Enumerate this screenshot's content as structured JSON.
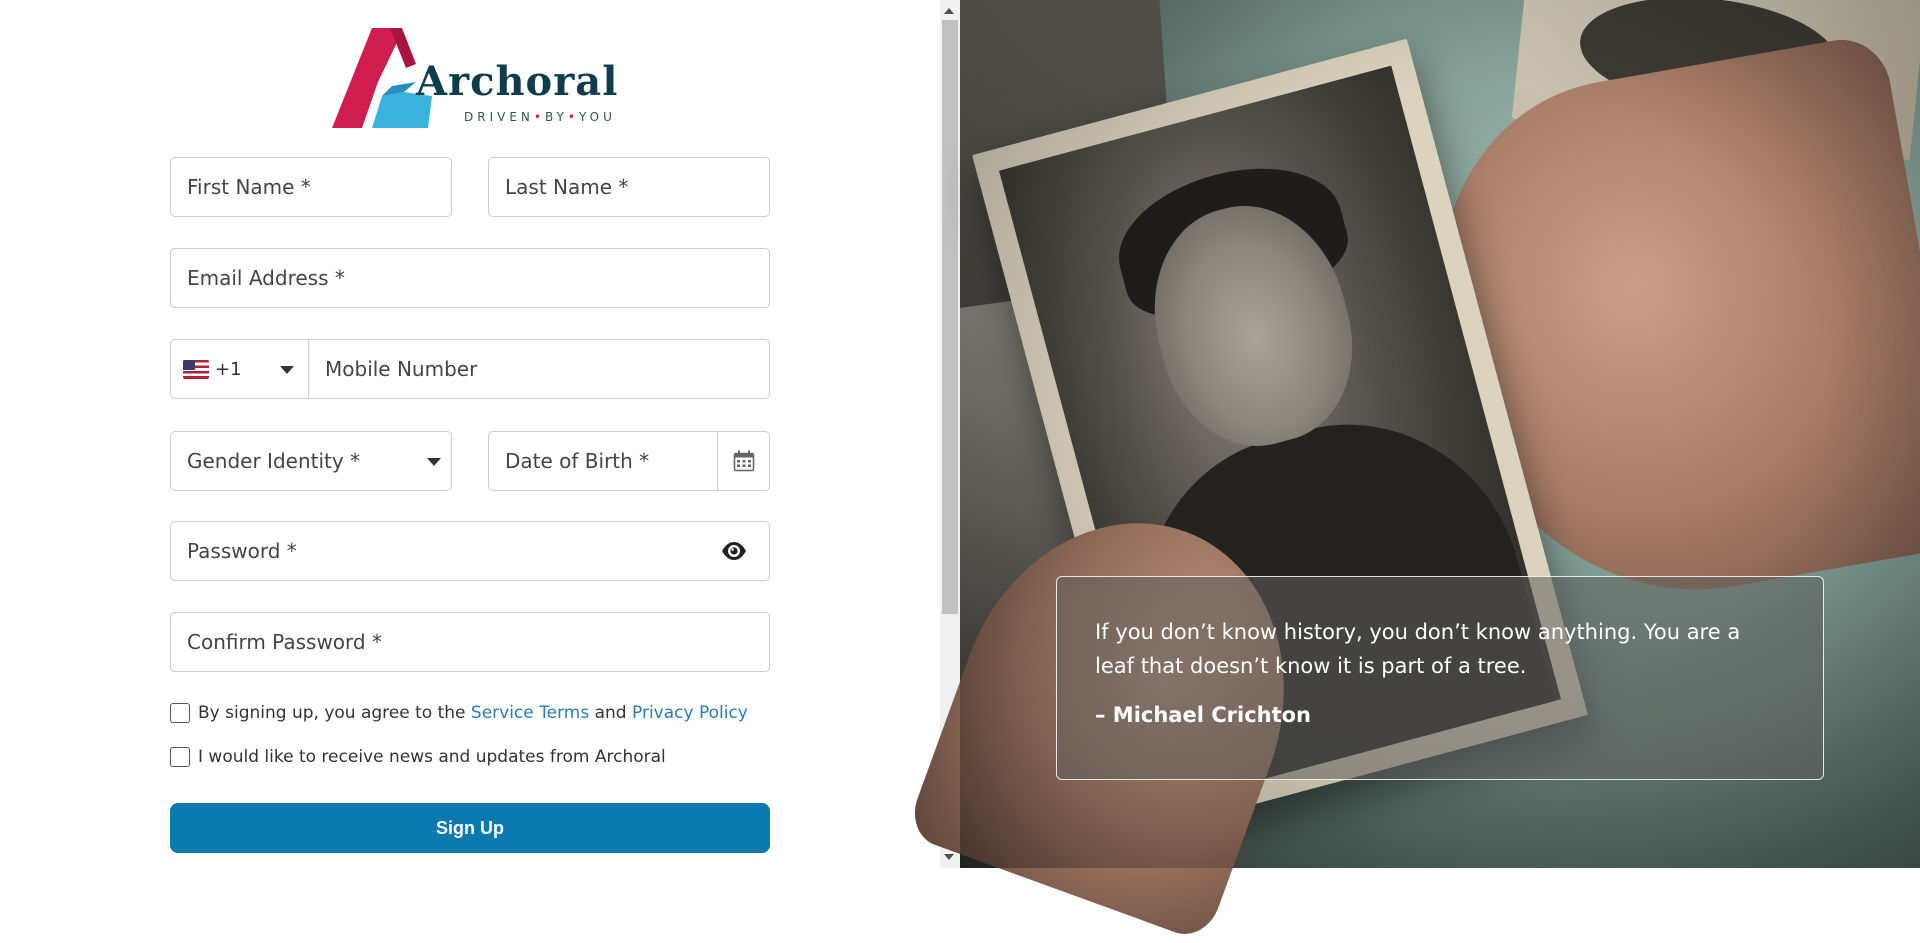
{
  "brand": {
    "name": "Archoral",
    "tagline_parts": [
      "DRIVEN",
      "BY",
      "YOU"
    ],
    "colors": {
      "primary": "#0b78ae",
      "logo_red": "#cf1d50",
      "logo_blue": "#3ab4dd",
      "logo_text": "#103d4e",
      "link": "#2a7bb5"
    }
  },
  "form": {
    "first_name": {
      "placeholder": "First Name *",
      "value": ""
    },
    "last_name": {
      "placeholder": "Last Name *",
      "value": ""
    },
    "email": {
      "placeholder": "Email Address *",
      "value": ""
    },
    "phone": {
      "country_flag": "us-flag-icon",
      "dial_code": "+1",
      "placeholder": "Mobile Number",
      "value": ""
    },
    "gender": {
      "placeholder": "Gender Identity *",
      "selected": ""
    },
    "dob": {
      "placeholder": "Date of Birth *",
      "value": "",
      "icon": "calendar-icon"
    },
    "password": {
      "placeholder": "Password *",
      "value": "",
      "icon": "eye-icon"
    },
    "confirm_password": {
      "placeholder": "Confirm Password *",
      "value": ""
    },
    "terms": {
      "text_before": "By signing up, you agree to the",
      "service_terms": "Service Terms",
      "and": "and",
      "privacy_policy": "Privacy Policy",
      "checked": false
    },
    "news": {
      "text": "I would like to receive news and updates from Archoral",
      "checked": false
    },
    "submit_label": "Sign Up"
  },
  "quote": {
    "text": "If you don’t know history, you don’t know anything. You are a leaf that doesn’t know it is part of a tree.",
    "author": "– Michael Crichton"
  }
}
